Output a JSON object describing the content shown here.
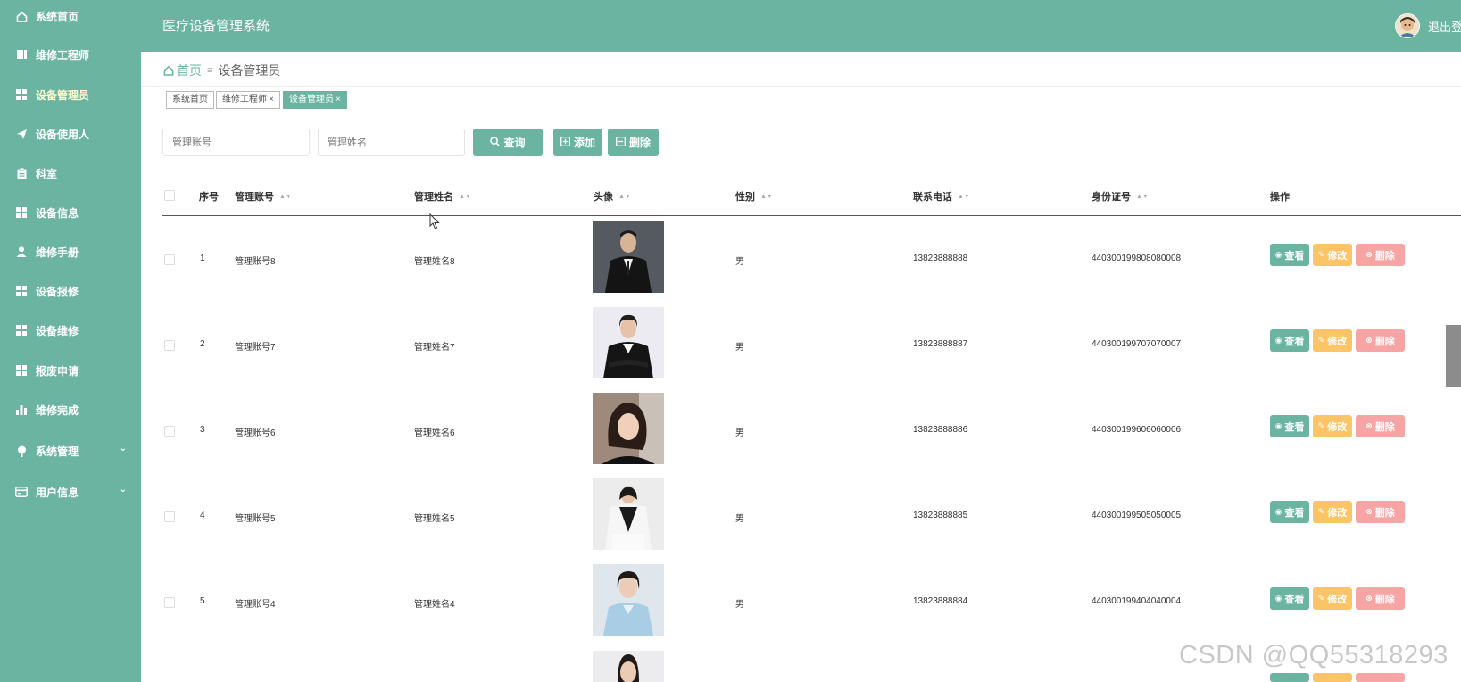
{
  "app": {
    "title": "医疗设备管理系统",
    "logout_label": "退出登"
  },
  "sidebar": {
    "items": [
      {
        "label": "系统首页",
        "icon": "home-icon"
      },
      {
        "label": "维修工程师",
        "icon": "book-icon"
      },
      {
        "label": "设备管理员",
        "icon": "grid-icon",
        "active": true
      },
      {
        "label": "设备使用人",
        "icon": "send-icon"
      },
      {
        "label": "科室",
        "icon": "clipboard-icon"
      },
      {
        "label": "设备信息",
        "icon": "grid-icon"
      },
      {
        "label": "维修手册",
        "icon": "user-icon"
      },
      {
        "label": "设备报修",
        "icon": "grid-icon"
      },
      {
        "label": "设备维修",
        "icon": "grid-icon"
      },
      {
        "label": "报废申请",
        "icon": "grid-icon"
      },
      {
        "label": "维修完成",
        "icon": "bar-chart-icon"
      },
      {
        "label": "系统管理",
        "icon": "pin-icon",
        "expandable": true
      },
      {
        "label": "用户信息",
        "icon": "id-card-icon",
        "expandable": true
      }
    ]
  },
  "breadcrumb": {
    "home": "首页",
    "current": "设备管理员"
  },
  "tags": [
    {
      "label": "系统首页"
    },
    {
      "label": "维修工程师",
      "close": "×"
    },
    {
      "label": "设备管理员",
      "close": "×",
      "active": true
    }
  ],
  "search": {
    "account_placeholder": "管理账号",
    "name_placeholder": "管理姓名",
    "query_label": "查询",
    "add_label": "添加",
    "delete_label": "删除"
  },
  "table": {
    "columns": [
      "序号",
      "管理账号",
      "管理姓名",
      "头像",
      "性别",
      "联系电话",
      "身份证号",
      "操作"
    ],
    "rows": [
      {
        "index": "1",
        "account": "管理账号8",
        "name": "管理姓名8",
        "gender": "男",
        "phone": "13823888888",
        "id_no": "440300199808080008"
      },
      {
        "index": "2",
        "account": "管理账号7",
        "name": "管理姓名7",
        "gender": "男",
        "phone": "13823888887",
        "id_no": "440300199707070007"
      },
      {
        "index": "3",
        "account": "管理账号6",
        "name": "管理姓名6",
        "gender": "男",
        "phone": "13823888886",
        "id_no": "440300199606060006"
      },
      {
        "index": "4",
        "account": "管理账号5",
        "name": "管理姓名5",
        "gender": "男",
        "phone": "13823888885",
        "id_no": "440300199505050005"
      },
      {
        "index": "5",
        "account": "管理账号4",
        "name": "管理姓名4",
        "gender": "男",
        "phone": "13823888884",
        "id_no": "440300199404040004"
      }
    ],
    "actions": {
      "view": "查看",
      "edit": "修改",
      "delete": "删除"
    }
  },
  "watermark": "CSDN @QQ55318293",
  "colors": {
    "primary": "#6bb4a1",
    "warning": "#fbc466",
    "danger": "#f7a4a4",
    "active_menu": "#fffbd0"
  }
}
